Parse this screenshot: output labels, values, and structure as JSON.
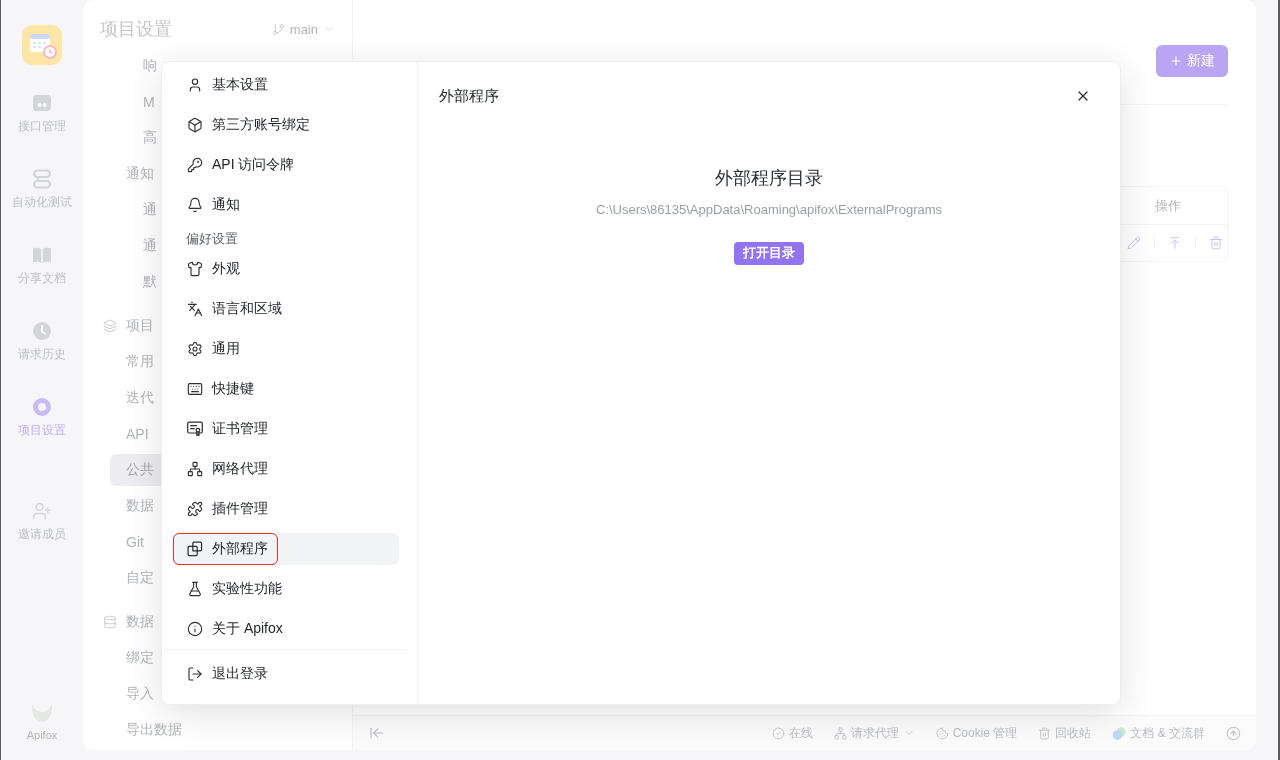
{
  "app_rail": {
    "nav_items": [
      {
        "label": "接口管理",
        "selected": false
      },
      {
        "label": "自动化测试",
        "selected": false
      },
      {
        "label": "分享文档",
        "selected": false
      },
      {
        "label": "请求历史",
        "selected": false
      },
      {
        "label": "项目设置",
        "selected": true
      }
    ],
    "footer_items": [
      {
        "label": "邀请成员",
        "selected": false
      }
    ],
    "brand": "Apifox"
  },
  "project_nav": {
    "title": "项目设置",
    "branch": "main",
    "groups": [
      {
        "items": [
          {
            "children": [
              {
                "label": "响",
                "selected": false
              },
              {
                "label": "M",
                "selected": false
              },
              {
                "label": "高",
                "selected": false
              }
            ]
          },
          {
            "label": "通知",
            "selected": false,
            "children": [
              {
                "label": "通",
                "selected": false
              },
              {
                "label": "通",
                "selected": false
              },
              {
                "label": "默",
                "selected": false
              }
            ]
          }
        ]
      },
      {
        "heading": "项目",
        "items": [
          {
            "label": "常用",
            "selected": false
          },
          {
            "label": "迭代",
            "selected": false
          },
          {
            "label": "API",
            "selected": false
          },
          {
            "label": "公共",
            "selected": true
          },
          {
            "label": "数据",
            "selected": false
          },
          {
            "label": "Git",
            "selected": false
          },
          {
            "label": "自定",
            "selected": false
          }
        ]
      },
      {
        "heading": "数据",
        "items": [
          {
            "label": "绑定",
            "selected": false
          },
          {
            "label": "导入",
            "selected": false
          },
          {
            "label": "导出数据",
            "selected": false
          }
        ]
      }
    ]
  },
  "main": {
    "new_button": "新建",
    "table": {
      "columns": [
        "操作"
      ]
    }
  },
  "dialog": {
    "menu": {
      "sections": [
        {
          "items": [
            {
              "label": "基本设置",
              "selected": false,
              "marked": false
            },
            {
              "label": "第三方账号绑定",
              "selected": false,
              "marked": false
            },
            {
              "label": "API 访问令牌",
              "selected": false,
              "marked": false
            },
            {
              "label": "通知",
              "selected": false,
              "marked": false
            }
          ]
        },
        {
          "heading": "偏好设置",
          "items": [
            {
              "label": "外观",
              "selected": false,
              "marked": false
            },
            {
              "label": "语言和区域",
              "selected": false,
              "marked": false
            },
            {
              "label": "通用",
              "selected": false,
              "marked": false
            },
            {
              "label": "快捷键",
              "selected": false,
              "marked": false
            },
            {
              "label": "证书管理",
              "selected": false,
              "marked": false
            },
            {
              "label": "网络代理",
              "selected": false,
              "marked": false
            },
            {
              "label": "插件管理",
              "selected": false,
              "marked": false
            },
            {
              "label": "外部程序",
              "selected": true,
              "marked": true
            },
            {
              "label": "实验性功能",
              "selected": false,
              "marked": false
            },
            {
              "label": "关于 Apifox",
              "selected": false,
              "marked": false
            }
          ]
        },
        {
          "items": [
            {
              "label": "退出登录",
              "selected": false,
              "marked": false
            }
          ]
        }
      ]
    },
    "title": "外部程序",
    "heading": "外部程序目录",
    "path": "C:\\Users\\86135\\AppData\\Roaming\\apifox\\ExternalPrograms",
    "open_button": "打开目录"
  },
  "status_bar": {
    "items": [
      {
        "label": "在线",
        "dropdown": false
      },
      {
        "label": "请求代理",
        "dropdown": true
      },
      {
        "label": "Cookie 管理",
        "dropdown": false
      },
      {
        "label": "回收站",
        "dropdown": false
      },
      {
        "label": "文档 & 交流群",
        "dropdown": false
      }
    ]
  }
}
